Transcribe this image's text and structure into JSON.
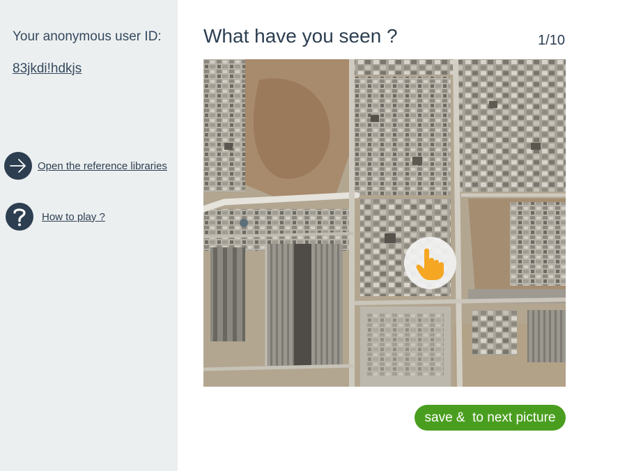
{
  "sidebar": {
    "user_id_label": "Your anonymous user ID:",
    "user_id_value": "83jkdi!hdkjs",
    "links": [
      {
        "label": "Open the reference libraries",
        "icon": "arrow-right-icon"
      },
      {
        "label": "How to play ?",
        "icon": "question-icon"
      }
    ]
  },
  "main": {
    "title": "What have you seen ?",
    "counter": "1/10",
    "image_pointer_icon": "hand-pointer-icon",
    "next_button_label": "save &  to next picture"
  },
  "colors": {
    "sidebar_bg": "#eceff0",
    "text_dark": "#2c3e50",
    "button_green": "#4a9e1f",
    "pointer_orange": "#f5a623"
  }
}
